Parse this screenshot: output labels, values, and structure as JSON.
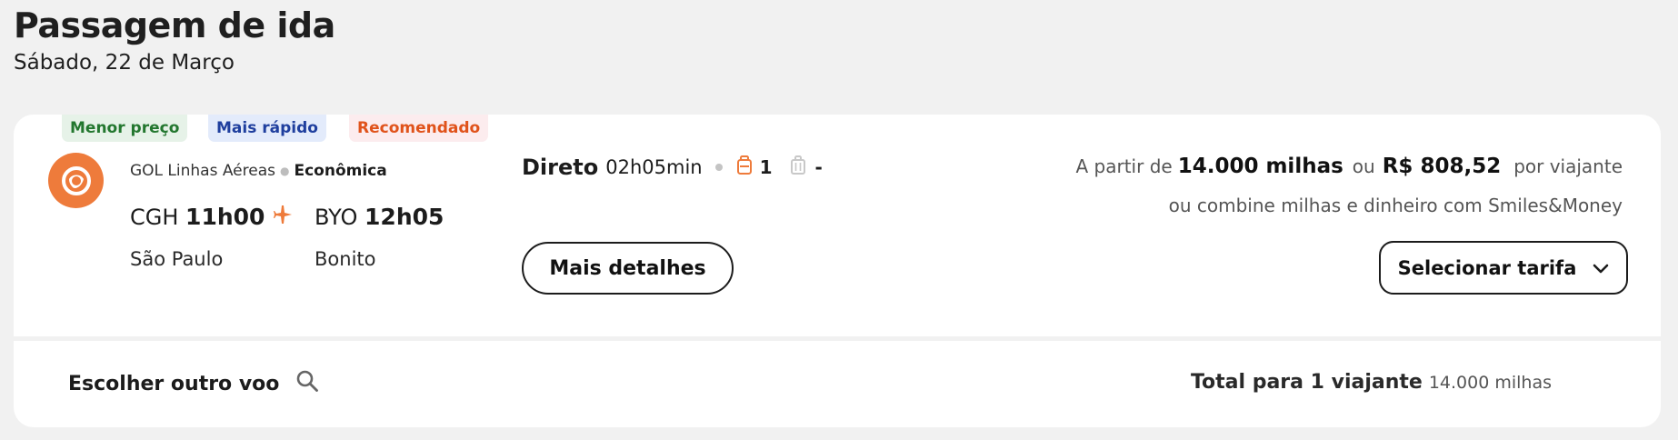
{
  "header": {
    "title": "Passagem de ida",
    "date": "Sábado, 22 de Março"
  },
  "flight_card": {
    "tags": {
      "cheapest": "Menor preço",
      "fastest": "Mais rápido",
      "recommended": "Recomendado"
    },
    "airline": "GOL Linhas Aéreas",
    "cabin": "Econômica",
    "origin": {
      "code": "CGH",
      "time": "11h00",
      "city": "São Paulo"
    },
    "destination": {
      "code": "BYO",
      "time": "12h05",
      "city": "Bonito"
    },
    "stops": "Direto",
    "duration": "02h05min",
    "carry_on_count": "1",
    "checked_bag_count": "-",
    "details_button": "Mais detalhes",
    "price": {
      "prefix": "A partir de",
      "miles": "14.000 milhas",
      "or": "ou",
      "cash": "R$ 808,52",
      "suffix": "por viajante",
      "combine": "ou combine milhas e dinheiro com Smiles&Money"
    },
    "fare_button": "Selecionar tarifa"
  },
  "footer": {
    "other_flight": "Escolher outro voo",
    "total_label": "Total para 1 viajante",
    "total_value": "14.000 milhas"
  },
  "icons": {
    "logo": "gol-logo-icon",
    "plane": "plane-icon",
    "carry_on": "carry-on-bag-icon",
    "checked": "checked-bag-icon",
    "fare_chevron": "chevron-down-icon",
    "search": "search-icon"
  },
  "colors": {
    "brand_orange": "#ee7b3b",
    "tag_green": "#23772f",
    "tag_blue": "#1f3f9e",
    "tag_orange": "#e0531b"
  }
}
